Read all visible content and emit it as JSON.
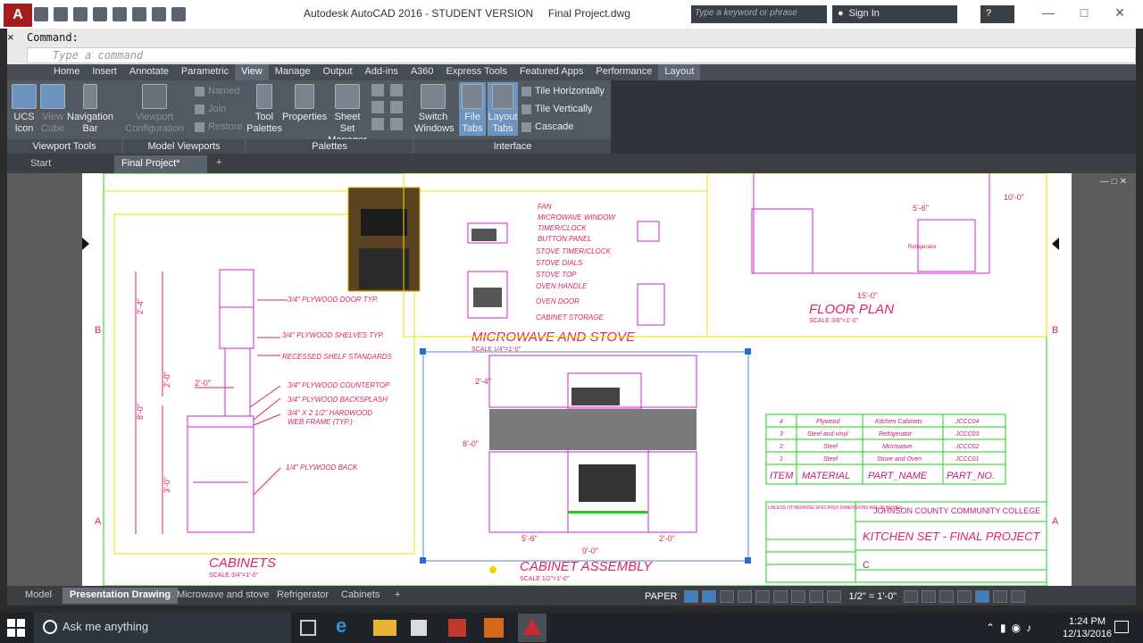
{
  "app": {
    "logo": "A",
    "title": "Autodesk AutoCAD 2016 - STUDENT VERSION     Final Project.dwg",
    "search_placeholder": "Type a keyword or phrase",
    "sign_in": "Sign In",
    "help": "?"
  },
  "command": {
    "label": "Command:",
    "placeholder": "Type a command",
    "close": "×"
  },
  "ribbon": {
    "tabs": [
      "Home",
      "Insert",
      "Annotate",
      "Parametric",
      "View",
      "Manage",
      "Output",
      "Add-ins",
      "A360",
      "Express Tools",
      "Featured Apps",
      "Performance",
      "Layout"
    ],
    "active_tab": "View",
    "viewport_tools": {
      "title": "Viewport Tools",
      "ucs_icon": "UCS Icon",
      "view_cube": "View Cube",
      "navigation_bar": "Navigation Bar"
    },
    "model_viewports": {
      "title": "Model Viewports",
      "viewport_configuration": "Viewport Configuration",
      "named": "Named",
      "join": "Join",
      "restore": "Restore"
    },
    "palettes": {
      "title": "Palettes",
      "tool_palettes": "Tool Palettes",
      "properties": "Properties",
      "sheet_set_manager": "Sheet Set Manager"
    },
    "interface": {
      "title": "Interface",
      "switch_windows": "Switch Windows",
      "file_tabs": "File Tabs",
      "layout_tabs": "Layout Tabs",
      "tile_horizontally": "Tile Horizontally",
      "tile_vertically": "Tile Vertically",
      "cascade": "Cascade"
    }
  },
  "file_tabs": {
    "start": "Start",
    "current": "Final Project*",
    "add": "+"
  },
  "drawing": {
    "titles": {
      "cabinets": "CABINETS",
      "cabinets_scale": "SCALE 3/4\"=1'-0\"",
      "microwave_stove": "MICROWAVE AND STOVE",
      "microwave_scale": "SCALE 1/4\"=1'-0\"",
      "cabinet_assembly": "CABINET ASSEMBLY",
      "assembly_scale": "SCALE 1/2\"=1'-0\"",
      "floor_plan": "FLOOR PLAN",
      "floor_scale": "SCALE 3/8\"=1'-0\""
    },
    "cabinet_notes": [
      "3/4\" PLYWOOD DOOR TYP.",
      "3/4\" PLYWOOD SHELVES TYP.",
      "RECESSED SHELF STANDARDS",
      "3/4\" PLYWOOD COUNTERTOP",
      "3/4\" PLYWOOD BACKSPLASH",
      "3/4\" X 2 1/2\" HARDWOOD",
      "WEB FRAME (TYP.)",
      "1/4\" PLYWOOD BACK"
    ],
    "appliance_notes": [
      "FAN",
      "MICROWAVE WINDOW",
      "TIMER/CLOCK",
      "BUTTON PANEL",
      "STOVE TIMER/CLOCK",
      "STOVE DIALS",
      "STOVE TOP",
      "OVEN HANDLE",
      "OVEN DOOR",
      "CABINET STORAGE"
    ],
    "floor_label": "Refrigerator",
    "parts_table": {
      "headers": [
        "ITEM",
        "MATERIAL",
        "PART_NAME",
        "PART_NO."
      ],
      "rows": [
        [
          "4",
          "Plywood",
          "Kitchen Cabinets",
          "JCCC04"
        ],
        [
          "3",
          "Steel and vinyl",
          "Refrigerator",
          "JCCC03"
        ],
        [
          "2",
          "Steel",
          "Microwave",
          "JCCC02"
        ],
        [
          "1",
          "Steel",
          "Stove and Oven",
          "JCCC01"
        ]
      ]
    },
    "title_block": {
      "school": "JOHNSON COUNTY COMMUNITY COLLEGE",
      "project": "KITCHEN SET - FINAL PROJECT",
      "size": "C",
      "tolerance_note": "UNLESS OTHERWISE SPECIFIED DIMENSIONS ARE IN INCHES"
    },
    "border_letters": [
      "B",
      "A"
    ],
    "dims": {
      "d1": "2'-4\"",
      "d2": "2'-0\"",
      "d3": "8'-0\"",
      "d4": "3'-0\"",
      "d5": "2'-0\"",
      "d6": "5'-6\"",
      "d7": "9'-0\"",
      "d8": "15'-0\"",
      "d9": "10'-0\"",
      "d10": "5'-6\""
    }
  },
  "layout_tabs": [
    "Model",
    "Presentation Drawing",
    "Microwave and stove",
    "Refrigerator",
    "Cabinets"
  ],
  "active_layout": "Presentation Drawing",
  "status": {
    "paper": "PAPER",
    "scale": "1/2\" = 1'-0\""
  },
  "taskbar": {
    "search": "Ask me anything",
    "time": "1:24 PM",
    "date": "12/13/2016"
  }
}
